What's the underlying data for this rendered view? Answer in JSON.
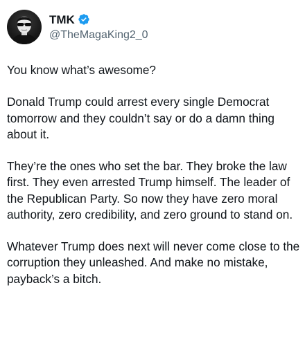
{
  "author": {
    "display_name": "TMK",
    "handle": "@TheMagaKing2_0",
    "verified": true,
    "avatar_icon": "avatar-man-sunglasses",
    "verified_icon": "verified-badge-icon",
    "verified_color": "#1d9bf0"
  },
  "post": {
    "paragraphs": [
      "You know what’s awesome?",
      "Donald Trump could arrest every single Democrat tomorrow and they couldn’t say or do a damn thing about it.",
      "They’re the ones who set the bar. They broke the law first. They even arrested Trump himself. The leader of the Republican Party. So now they have zero moral authority, zero credibility, and zero ground to stand on.",
      "Whatever Trump does next will never come close to the corruption they unleashed. And make no mistake, payback’s a bitch."
    ]
  }
}
